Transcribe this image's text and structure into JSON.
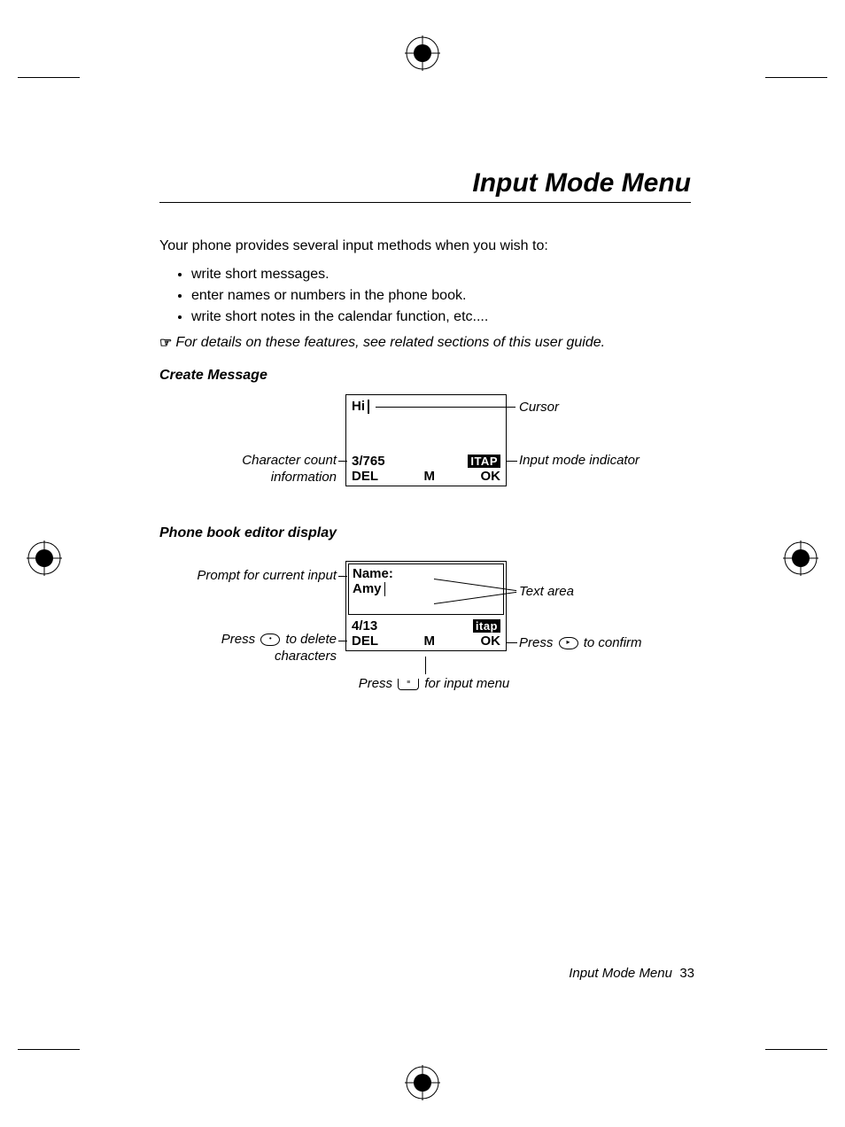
{
  "title": "Input Mode Menu",
  "intro": "Your phone provides several input methods when you wish to:",
  "bullets": [
    "write short messages.",
    "enter names or numbers in the phone book.",
    "write short notes in the calendar function, etc...."
  ],
  "note": "For details on these features, see related sections of this user guide.",
  "sections": {
    "create": "Create Message",
    "phonebook": "Phone book editor display"
  },
  "diagram1": {
    "text": "Hi",
    "count": "3/765",
    "mode": "ITAP",
    "softkeys": {
      "left": "DEL",
      "mid": "M",
      "right": "OK"
    },
    "callouts": {
      "cursor": "Cursor",
      "charcount_l1": "Character count",
      "charcount_l2": "information",
      "mode": "Input mode indicator"
    }
  },
  "diagram2": {
    "prompt": "Name:",
    "text": "Amy",
    "count": "4/13",
    "mode": "itap",
    "softkeys": {
      "left": "DEL",
      "mid": "M",
      "right": "OK"
    },
    "callouts": {
      "prompt": "Prompt for current input",
      "textarea": "Text area",
      "del_l1": "Press",
      "del_l2": "to delete",
      "del_l3": "characters",
      "ok_l1": "Press",
      "ok_l2": "to confirm",
      "menu_l1": "Press",
      "menu_l2": "for input menu"
    }
  },
  "footer": {
    "label": "Input Mode Menu",
    "page": "33"
  }
}
